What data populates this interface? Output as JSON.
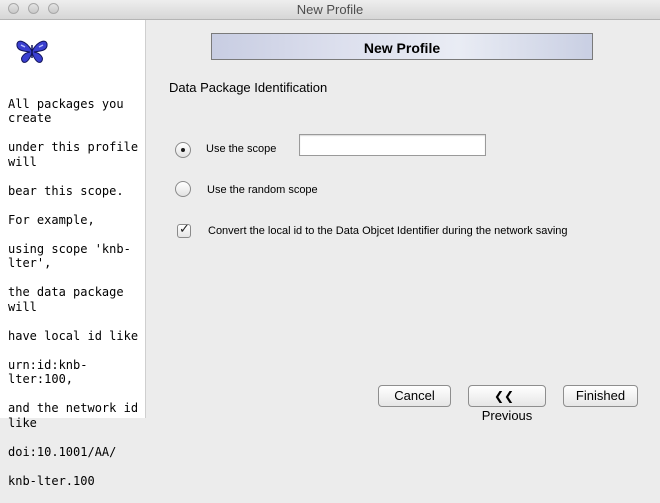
{
  "window": {
    "title": "New Profile"
  },
  "sidebar": {
    "lines": [
      "All packages you create",
      "under this profile will",
      "bear this scope.",
      "For example,",
      "using scope 'knb-lter',",
      "the data package will",
      "have local id like",
      "urn:id:knb-lter:100,",
      "and the network id like",
      "doi:10.1001/AA/",
      "knb-lter.100"
    ]
  },
  "banner": {
    "title": "New Profile"
  },
  "section": {
    "title": "Data Package Identification"
  },
  "options": {
    "use_scope": {
      "label": "Use the scope",
      "selected": true
    },
    "random_scope": {
      "label": "Use the random scope",
      "selected": false
    },
    "scope_value": "",
    "convert": {
      "label": "Convert the local id to the Data Objcet Identifier during the network saving",
      "checked": true
    }
  },
  "buttons": {
    "cancel": "Cancel",
    "previous": "Previous",
    "finished": "Finished"
  }
}
